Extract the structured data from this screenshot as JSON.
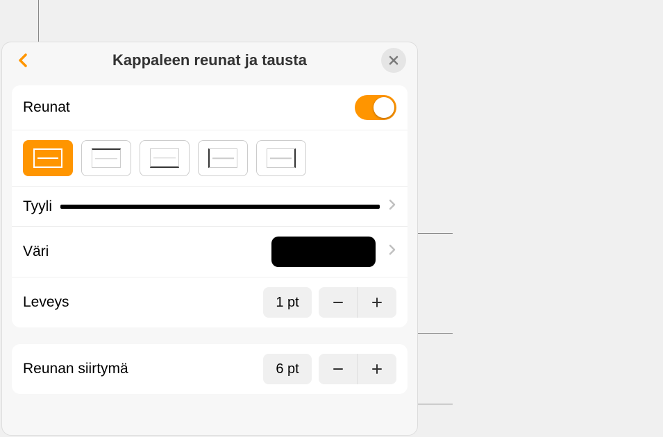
{
  "header": {
    "title": "Kappaleen reunat ja tausta"
  },
  "borders": {
    "label": "Reunat",
    "toggle_on": true
  },
  "style": {
    "label": "Tyyli"
  },
  "color": {
    "label": "Väri"
  },
  "width": {
    "label": "Leveys",
    "value": "1 pt"
  },
  "offset": {
    "label": "Reunan siirtymä",
    "value": "6 pt"
  }
}
